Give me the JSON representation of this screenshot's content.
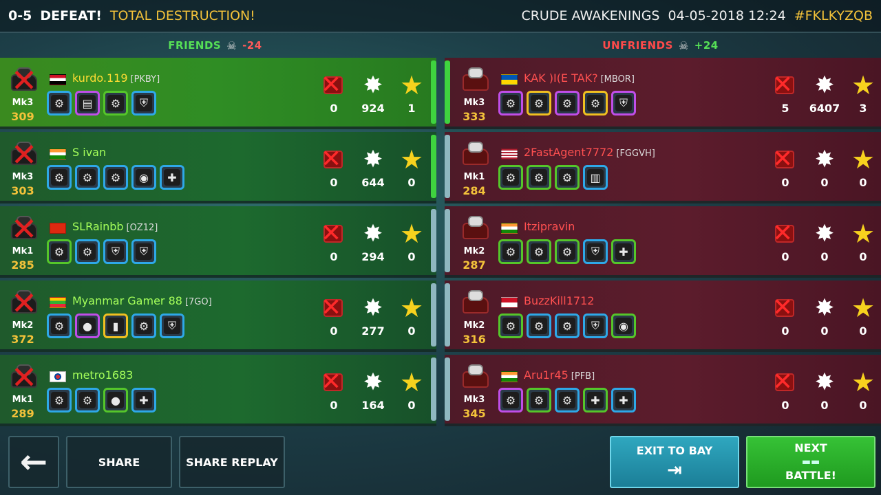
{
  "header": {
    "score": "0-5",
    "result": "DEFEAT!",
    "subresult": "TOTAL DESTRUCTION!",
    "map": "CRUDE AWAKENINGS",
    "datetime": "04-05-2018 12:24",
    "code": "#FKLKYZQB"
  },
  "teams": {
    "friends": {
      "label": "FRIENDS",
      "delta": "-24"
    },
    "unfriends": {
      "label": "UNFRIENDS",
      "delta": "+24"
    }
  },
  "friends": [
    {
      "name": "kurdo.119",
      "tag": "[PKBY]",
      "mk": "Mk3",
      "rating": "309",
      "kills": "0",
      "damage": "924",
      "stars": "1",
      "flag_colors": [
        "#ce1126",
        "#ffffff",
        "#000000"
      ]
    },
    {
      "name": "S ivan",
      "tag": "",
      "mk": "Mk3",
      "rating": "303",
      "kills": "0",
      "damage": "644",
      "stars": "0",
      "flag_colors": [
        "#ff9933",
        "#ffffff",
        "#138808"
      ]
    },
    {
      "name": "SLRainbb",
      "tag": "[OZ12]",
      "mk": "Mk1",
      "rating": "285",
      "kills": "0",
      "damage": "294",
      "stars": "0",
      "flag_colors": [
        "#de2910",
        "#de2910",
        "#de2910"
      ]
    },
    {
      "name": "Myanmar Gamer 88",
      "tag": "[7GO]",
      "mk": "Mk2",
      "rating": "372",
      "kills": "0",
      "damage": "277",
      "stars": "0",
      "flag_colors": [
        "#fecb00",
        "#34b233",
        "#ea2839"
      ]
    },
    {
      "name": "metro1683",
      "tag": "",
      "mk": "Mk1",
      "rating": "289",
      "kills": "0",
      "damage": "164",
      "stars": "0",
      "flag_colors": [
        "#ffffff",
        "#ffffff",
        "#ffffff"
      ]
    }
  ],
  "unfriends": [
    {
      "name": "KAK )I(E TAK?",
      "tag": "[MBOR]",
      "mk": "Mk3",
      "rating": "333",
      "kills": "5",
      "damage": "6407",
      "stars": "3",
      "flag_colors": [
        "#0057b7",
        "#0057b7",
        "#ffd700"
      ]
    },
    {
      "name": "2FastAgent7772",
      "tag": "[FGGVH]",
      "mk": "Mk1",
      "rating": "284",
      "kills": "0",
      "damage": "0",
      "stars": "0",
      "flag_colors": [
        "#b22234",
        "#ffffff",
        "#3c3b6e"
      ]
    },
    {
      "name": "Itzipravin",
      "tag": "",
      "mk": "Mk2",
      "rating": "287",
      "kills": "0",
      "damage": "0",
      "stars": "0",
      "flag_colors": [
        "#ff9933",
        "#ffffff",
        "#138808"
      ]
    },
    {
      "name": "BuzzKill1712",
      "tag": "",
      "mk": "Mk2",
      "rating": "316",
      "kills": "0",
      "damage": "0",
      "stars": "0",
      "flag_colors": [
        "#ce1126",
        "#ce1126",
        "#ffffff"
      ]
    },
    {
      "name": "Aru1r45",
      "tag": "[PFB]",
      "mk": "Mk3",
      "rating": "345",
      "kills": "0",
      "damage": "0",
      "stars": "0",
      "flag_colors": [
        "#ff9933",
        "#ffffff",
        "#138808"
      ]
    }
  ],
  "buttons": {
    "back": "←",
    "share": "SHARE",
    "share_replay": "SHARE REPLAY",
    "exit": "EXIT TO BAY",
    "next_line1": "NEXT",
    "next_line2": "BATTLE!"
  }
}
